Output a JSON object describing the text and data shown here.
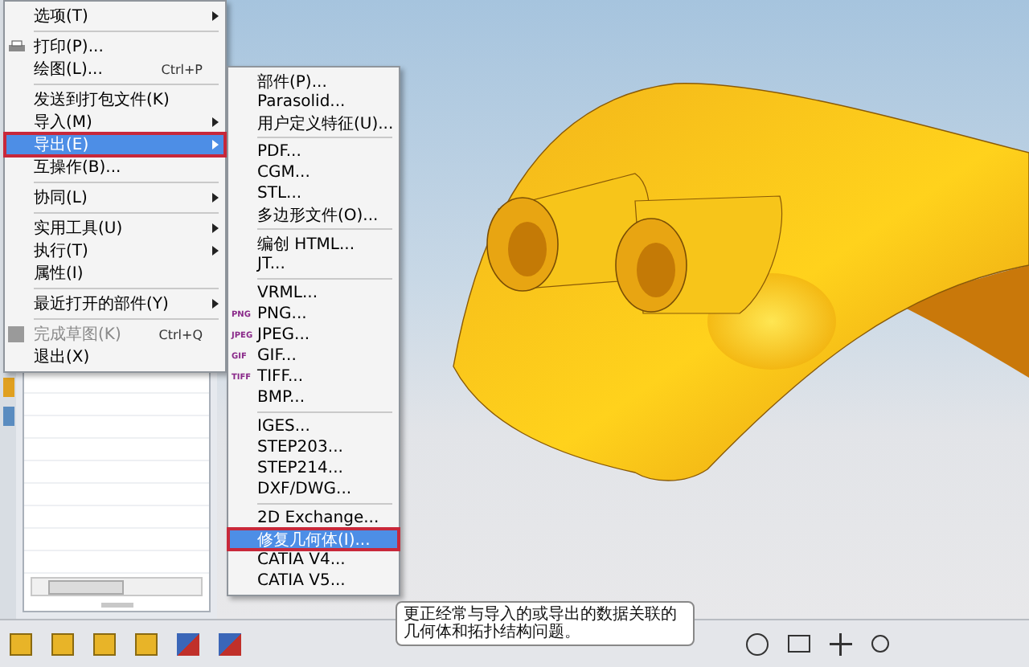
{
  "file_menu": {
    "items": [
      {
        "kind": "item",
        "label": "选项(T)",
        "submenu": true,
        "selected": false,
        "disabled": false
      },
      {
        "kind": "separator"
      },
      {
        "kind": "print",
        "label": "打印(P)...",
        "submenu": false,
        "selected": false,
        "disabled": false
      },
      {
        "kind": "item",
        "label": "绘图(L)...",
        "shortcut": "Ctrl+P",
        "submenu": false,
        "selected": false,
        "disabled": false
      },
      {
        "kind": "separator"
      },
      {
        "kind": "item",
        "label": "发送到打包文件(K)",
        "submenu": false,
        "selected": false,
        "disabled": false
      },
      {
        "kind": "item",
        "label": "导入(M)",
        "submenu": true,
        "selected": false,
        "disabled": false
      },
      {
        "kind": "item",
        "label": "导出(E)",
        "submenu": true,
        "selected": true,
        "disabled": false
      },
      {
        "kind": "item",
        "label": "互操作(B)...",
        "submenu": false,
        "selected": false,
        "disabled": false
      },
      {
        "kind": "separator"
      },
      {
        "kind": "item",
        "label": "协同(L)",
        "submenu": true,
        "selected": false,
        "disabled": false
      },
      {
        "kind": "separator"
      },
      {
        "kind": "item",
        "label": "实用工具(U)",
        "submenu": true,
        "selected": false,
        "disabled": false
      },
      {
        "kind": "item",
        "label": "执行(T)",
        "submenu": true,
        "selected": false,
        "disabled": false
      },
      {
        "kind": "item",
        "label": "属性(I)",
        "submenu": false,
        "selected": false,
        "disabled": false
      },
      {
        "kind": "separator"
      },
      {
        "kind": "item",
        "label": "最近打开的部件(Y)",
        "submenu": true,
        "selected": false,
        "disabled": false
      },
      {
        "kind": "separator"
      },
      {
        "kind": "finish",
        "label": "完成草图(K)",
        "shortcut": "Ctrl+Q",
        "submenu": false,
        "selected": false,
        "disabled": true
      },
      {
        "kind": "item",
        "label": "退出(X)",
        "submenu": false,
        "selected": false,
        "disabled": false
      }
    ]
  },
  "export_submenu": {
    "items": [
      {
        "kind": "item",
        "label": "部件(P)...",
        "selected": false
      },
      {
        "kind": "item",
        "label": "Parasolid...",
        "selected": false
      },
      {
        "kind": "item",
        "label": "用户定义特征(U)...",
        "selected": false
      },
      {
        "kind": "separator"
      },
      {
        "kind": "item",
        "label": "PDF...",
        "selected": false
      },
      {
        "kind": "item",
        "label": "CGM...",
        "selected": false
      },
      {
        "kind": "item",
        "label": "STL...",
        "selected": false
      },
      {
        "kind": "item",
        "label": "多边形文件(O)...",
        "selected": false
      },
      {
        "kind": "separator"
      },
      {
        "kind": "item",
        "label": "编创 HTML...",
        "selected": false
      },
      {
        "kind": "item",
        "label": "JT...",
        "selected": false
      },
      {
        "kind": "separator"
      },
      {
        "kind": "item",
        "label": "VRML...",
        "selected": false
      },
      {
        "kind": "item",
        "label": "PNG...",
        "badge": "PNG",
        "selected": false
      },
      {
        "kind": "item",
        "label": "JPEG...",
        "badge": "JPEG",
        "selected": false
      },
      {
        "kind": "item",
        "label": "GIF...",
        "badge": "GIF",
        "selected": false
      },
      {
        "kind": "item",
        "label": "TIFF...",
        "badge": "TIFF",
        "selected": false
      },
      {
        "kind": "item",
        "label": "BMP...",
        "selected": false
      },
      {
        "kind": "separator"
      },
      {
        "kind": "item",
        "label": "IGES...",
        "selected": false
      },
      {
        "kind": "item",
        "label": "STEP203...",
        "selected": false
      },
      {
        "kind": "item",
        "label": "STEP214...",
        "selected": false
      },
      {
        "kind": "item",
        "label": "DXF/DWG...",
        "selected": false
      },
      {
        "kind": "separator"
      },
      {
        "kind": "item",
        "label": "2D Exchange...",
        "selected": false
      },
      {
        "kind": "item",
        "label": "修复几何体(I)...",
        "selected": true
      },
      {
        "kind": "item",
        "label": "CATIA V4...",
        "selected": false
      },
      {
        "kind": "item",
        "label": "CATIA V5...",
        "selected": false
      }
    ]
  },
  "tooltip": {
    "text": "更正经常与导入的或导出的数据关联的几何体和拓扑结构问题。"
  }
}
